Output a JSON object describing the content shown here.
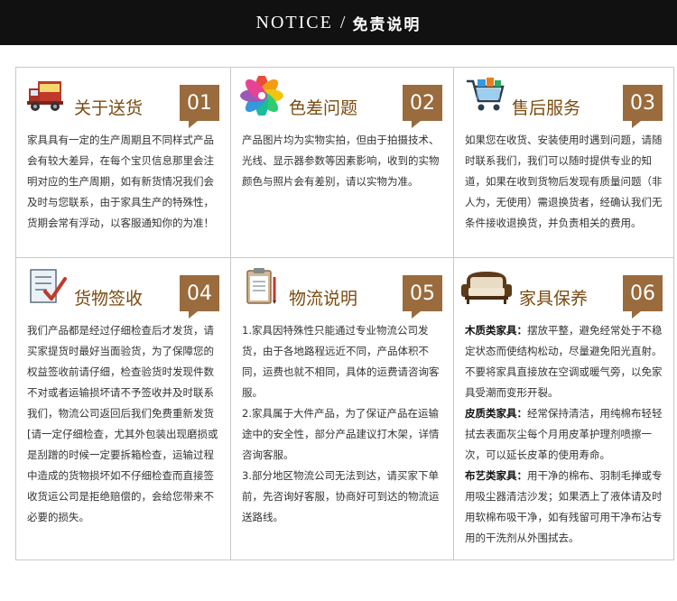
{
  "banner": {
    "en": "NOTICE",
    "sep": "/",
    "cn": "免责说明"
  },
  "cells": [
    {
      "title": "关于送货",
      "num": "01",
      "lines": [
        "家具具有一定的生产周期且不同样式产品会有较大差异，在每个宝贝信息那里会注明对应的生产周期，如有新货情况我们会及时与您联系，由于家具生产的特殊性，货期会常有浮动，以客服通知你的为准！"
      ]
    },
    {
      "title": "色差问题",
      "num": "02",
      "lines": [
        "产品图片均为实物实拍，但由于拍摄技术、光线、显示器参数等因素影响，收到的实物颜色与照片会有差别，请以实物为准。"
      ]
    },
    {
      "title": "售后服务",
      "num": "03",
      "lines": [
        "如果您在收货、安装使用时遇到问题，请随时联系我们，我们可以随时提供专业的知道，如果在收到货物后发现有质量问题（非人为，无使用）需退换货者，经确认我们无条件接收退换货，并负责相关的费用。"
      ]
    },
    {
      "title": "货物签收",
      "num": "04",
      "lines": [
        "我们产品都是经过仔细检查后才发货，请买家提货时最好当面验货，为了保障您的权益签收前请仔细，检查验货时发现件数不对或者运输损坏请不予签收并及时联系我们，物流公司返回后我们免费重新发货[请一定仔细检查，尤其外包装出现磨损或是刮蹭的时候一定要拆箱检查，运输过程中造成的货物损坏如不仔细检查而直接签收货运公司是拒绝赔偿的，会给您带来不必要的损失。"
      ]
    },
    {
      "title": "物流说明",
      "num": "05",
      "lines": [
        "1.家具因特殊性只能通过专业物流公司发货，由于各地路程远近不同，产品体积不同，运费也就不相同，具体的运费请咨询客服。",
        "2.家具属于大件产品，为了保证产品在运输途中的安全性，部分产品建议打木架，详情咨询客服。",
        "3.部分地区物流公司无法到达，请买家下单前，先咨询好客服，协商好可到达的物流运送路线。"
      ]
    },
    {
      "title": "家具保养",
      "num": "06",
      "sections": [
        {
          "label": "木质类家具：",
          "text": "摆放平整，避免经常处于不稳定状态而使结构松动，尽量避免阳光直射。不要将家具直接放在空调或暖气旁，以免家具受潮而变形开裂。"
        },
        {
          "label": "皮质类家具：",
          "text": "经常保持清洁，用纯棉布轻轻拭去表面灰尘每个月用皮革护理剂喷擦一次，可以延长皮革的使用寿命。"
        },
        {
          "label": "布艺类家具：",
          "text": "用干净的棉布、羽制毛掸或专用吸尘器清洁沙发；如果洒上了液体请及时用软棉布吸干净，如有残留可用干净布沾专用的干洗剂从外围拭去。"
        }
      ]
    }
  ],
  "icons": [
    "truck-icon",
    "color-wheel-icon",
    "shopping-cart-icon",
    "checklist-icon",
    "clipboard-icon",
    "sofa-icon"
  ],
  "colors": {
    "banner_bg": "#111111",
    "accent": "#9a6b3c",
    "title": "#7a4b10"
  }
}
